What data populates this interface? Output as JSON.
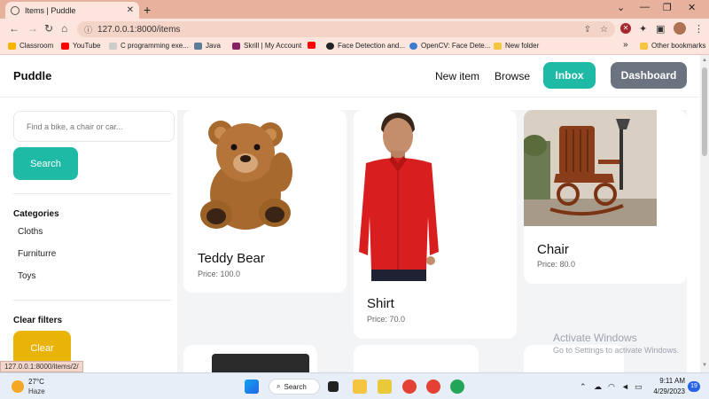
{
  "browser": {
    "tab_title": "Items | Puddle",
    "tab_close": "✕",
    "new_tab": "+",
    "window_controls": [
      "⌄",
      "—",
      "❐",
      "✕"
    ],
    "url": "127.0.0.1:8000/items",
    "toolbar_icons": [
      "share-icon",
      "star-icon",
      "extension-x-icon",
      "puzzle-icon",
      "sidepanel-icon",
      "profile-avatar",
      "kebab-menu-icon"
    ],
    "bookmarks": [
      {
        "label": "Classroom",
        "icon": "classroom-icon",
        "color": "#f4b400"
      },
      {
        "label": "YouTube",
        "icon": "youtube-icon",
        "color": "#ff0000"
      },
      {
        "label": "C programming exe...",
        "icon": "w3-icon",
        "color": "#cccccc"
      },
      {
        "label": "Java",
        "icon": "java-icon",
        "color": "#5b7d9a"
      },
      {
        "label": "Skrill | My Account",
        "icon": "skrill-icon",
        "color": "#862165"
      },
      {
        "label": "",
        "icon": "youtube-icon",
        "color": "#ff0000"
      },
      {
        "label": "Face Detection and...",
        "icon": "github-icon",
        "color": "#222222"
      },
      {
        "label": "OpenCV: Face Dete...",
        "icon": "opencv-icon",
        "color": "#3b7cd1"
      },
      {
        "label": "New folder",
        "icon": "folder-icon",
        "color": "#f5c542"
      }
    ],
    "bookmarks_more": "»",
    "other_bookmarks": "Other bookmarks",
    "status_url": "127.0.0.1:8000/items/2/"
  },
  "navbar": {
    "brand": "Puddle",
    "new_item": "New item",
    "browse": "Browse",
    "inbox": "Inbox",
    "dashboard": "Dashboard"
  },
  "sidebar": {
    "search_placeholder": "Find a bike, a chair or car...",
    "search_button": "Search",
    "categories_heading": "Categories",
    "categories": [
      "Cloths",
      "Furniturre",
      "Toys"
    ],
    "clear_heading": "Clear filters",
    "clear_button": "Clear"
  },
  "items": [
    {
      "name": "Teddy Bear",
      "price": "Price: 100.0",
      "image": "teddy-bear-image"
    },
    {
      "name": "Shirt",
      "price": "Price: 70.0",
      "image": "red-shirt-image"
    },
    {
      "name": "Chair",
      "price": "Price: 80.0",
      "image": "rocking-chair-image"
    }
  ],
  "watermark": {
    "line1": "Activate Windows",
    "line2": "Go to Settings to activate Windows."
  },
  "taskbar": {
    "temperature": "27°C",
    "condition": "Haze",
    "search_label": "Search",
    "time": "9:11 AM",
    "date": "4/29/2023",
    "notifications": "19"
  },
  "colors": {
    "accent_teal": "#1fbaa6",
    "dashboard_gray": "#6b7280",
    "clear_yellow": "#eab308",
    "tab_strip": "#e8b19d"
  }
}
